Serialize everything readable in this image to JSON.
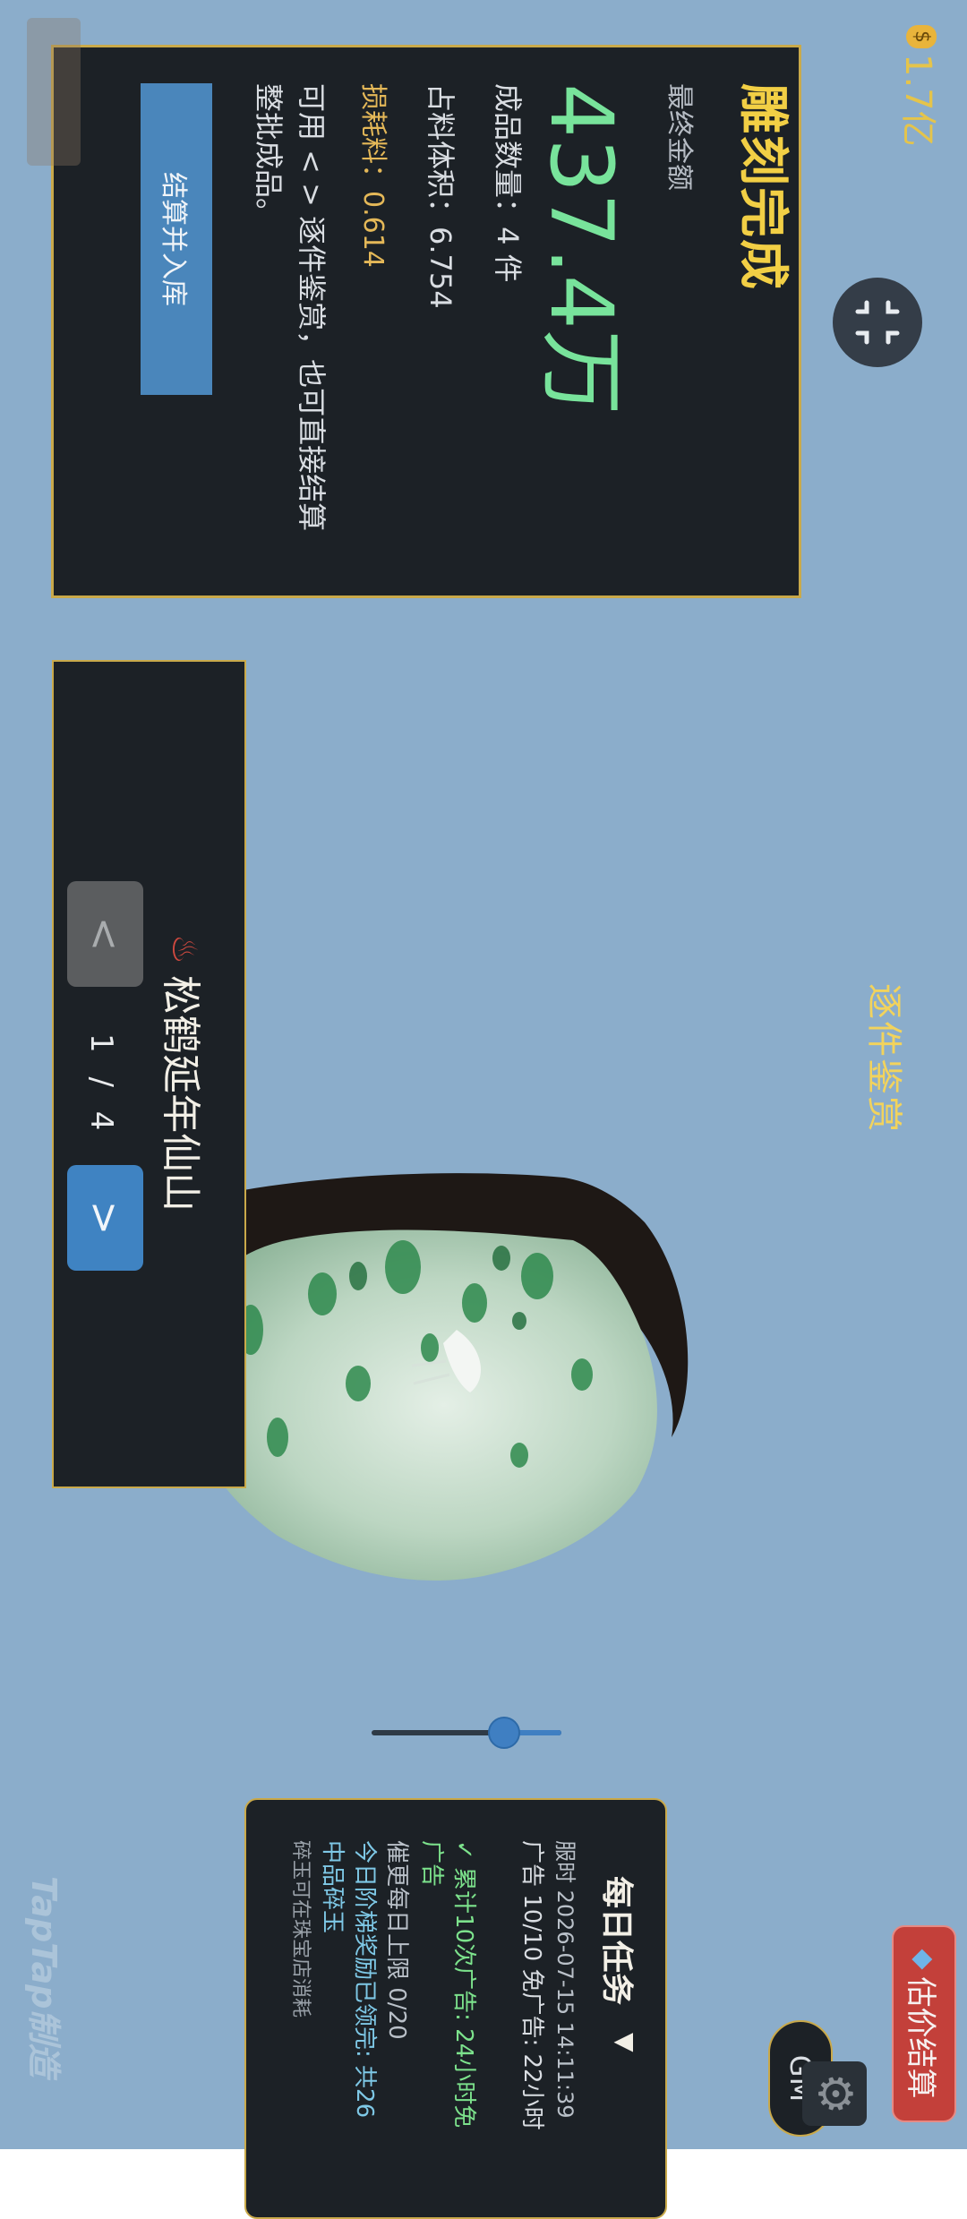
{
  "top_bar": {
    "currency_icon": "money-bag-icon",
    "currency_amount": "1.7亿",
    "collapse_icon": "collapse-arrows-icon"
  },
  "result_panel": {
    "title": "雕刻完成",
    "subtitle": "最终金额",
    "amount": "437.4万",
    "count": "成品数量：4 件",
    "volume": "占料体积：6.754",
    "loss": "损耗料：0.614",
    "hint": "可用 < > 逐件鉴赏，也可直接结算整批成品。",
    "settle_button": "结算并入库"
  },
  "appreciation": {
    "title": "逐件鉴赏",
    "item_name": "松鹤延年仙山",
    "item_icon": "heat-waves-icon",
    "prev_label": "<",
    "next_label": ">",
    "page": "1 / 4"
  },
  "slider": {
    "value": 0.3
  },
  "daily_tasks": {
    "title": "每日任务",
    "toggle_icon": "triangle-down-icon",
    "server_time": "服时 2026-07-15 14:11:39",
    "ads": "广告 10/10  免广告: 22小时",
    "reward": "✓ 累计10次广告: 24小时免广告",
    "limit": "催更每日上限 0/20",
    "step_reward": "今日阶梯奖励已领完: 共26中品碎玉",
    "tip": "碎玉可在珠宝店消耗"
  },
  "bottom_buttons": {
    "gm_label": "GM",
    "settings_icon": "gear-icon",
    "estimate_label": "估价结算",
    "estimate_icon": "diamond-icon"
  },
  "watermark": "TapTap制造",
  "colors": {
    "background": "#8badcb",
    "panel": "#1c2126",
    "border_gold": "#c9a94a",
    "title_gold": "#f2cf45",
    "amount_green": "#78e39b",
    "button_blue": "#4a86bb",
    "button_red": "#c3403a"
  }
}
